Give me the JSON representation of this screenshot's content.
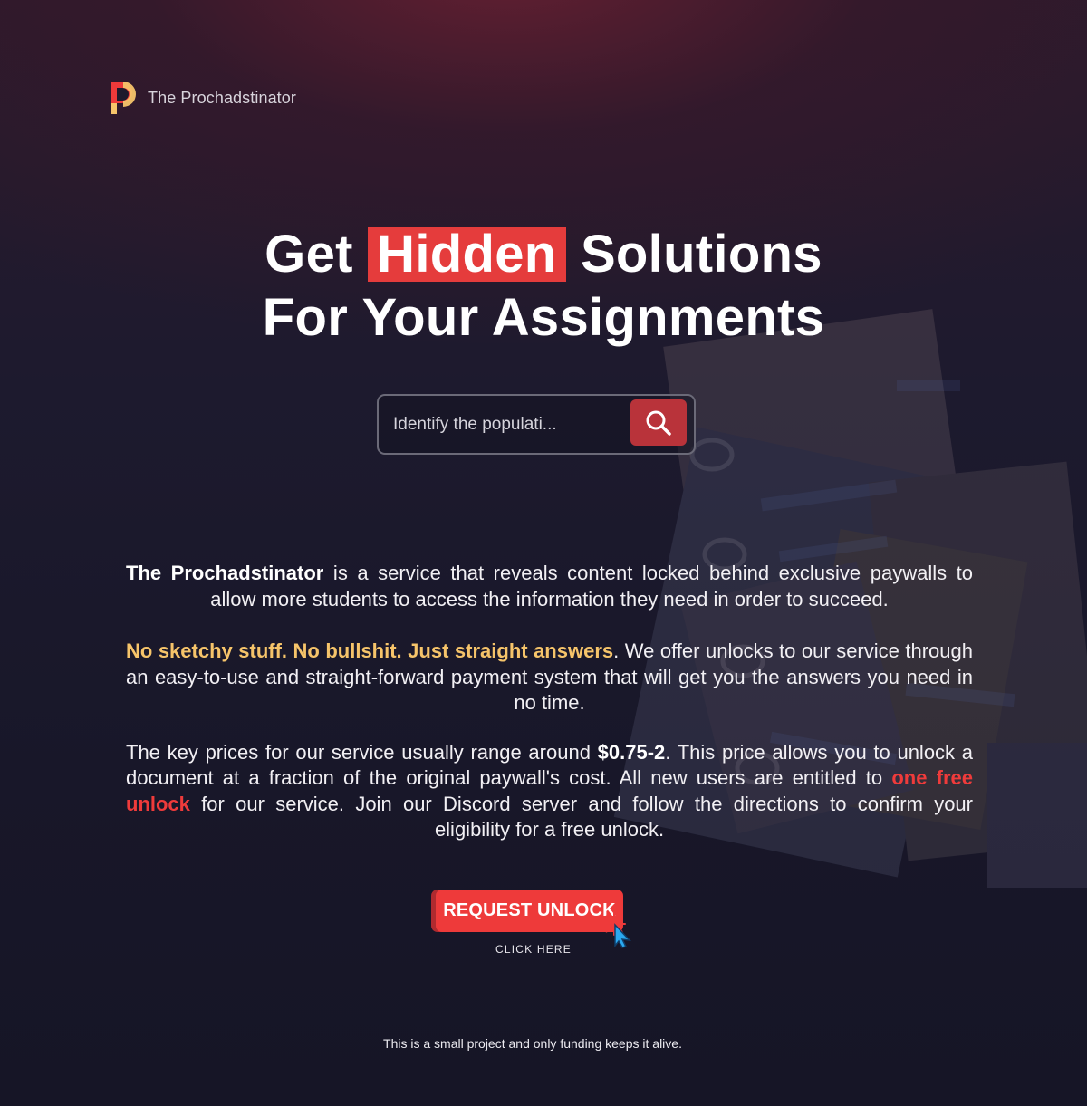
{
  "brand": {
    "name": "The Prochadstinator",
    "logo_icon": "prochadstinator-logo-icon",
    "logo_colors": [
      "#ee3a3a",
      "#f6c46a"
    ]
  },
  "hero": {
    "title_before": "Get",
    "title_highlight": "Hidden",
    "title_after": "Solutions",
    "title_line2": "For Your Assignments"
  },
  "search": {
    "value": "Identify the populati...",
    "placeholder": "Identify the populati...",
    "button_icon": "search-icon"
  },
  "about": {
    "p1_strong": "The Prochadstinator",
    "p1_rest": " is a service that reveals content locked behind exclusive paywalls to allow more students to access the information they need in order to succeed.",
    "p2_strong": "No sketchy stuff. No bullshit. Just straight answers",
    "p2_rest": ". We offer unlocks to our service through an easy-to-use and straight-forward payment system that will get you the answers you need in no time.",
    "p3_a": "The key prices for our service usually range around ",
    "p3_price": "$0.75-2",
    "p3_b": ". This price allows you to unlock a document at a fraction of the original paywall's cost. All new users are entitled to ",
    "p3_free": "one free unlock",
    "p3_c": " for our service. Join our Discord server and follow the directions to confirm your eligibility for a free unlock."
  },
  "cta": {
    "label": "REQUEST UNLOCK",
    "hint": "CLICK HERE",
    "cursor_icon": "click-cursor-icon"
  },
  "footer": {
    "note": "This is a small project and only funding keeps it alive."
  },
  "colors": {
    "accent_red": "#ee3a3a",
    "accent_yellow": "#f6c46a",
    "background": "#181729"
  }
}
